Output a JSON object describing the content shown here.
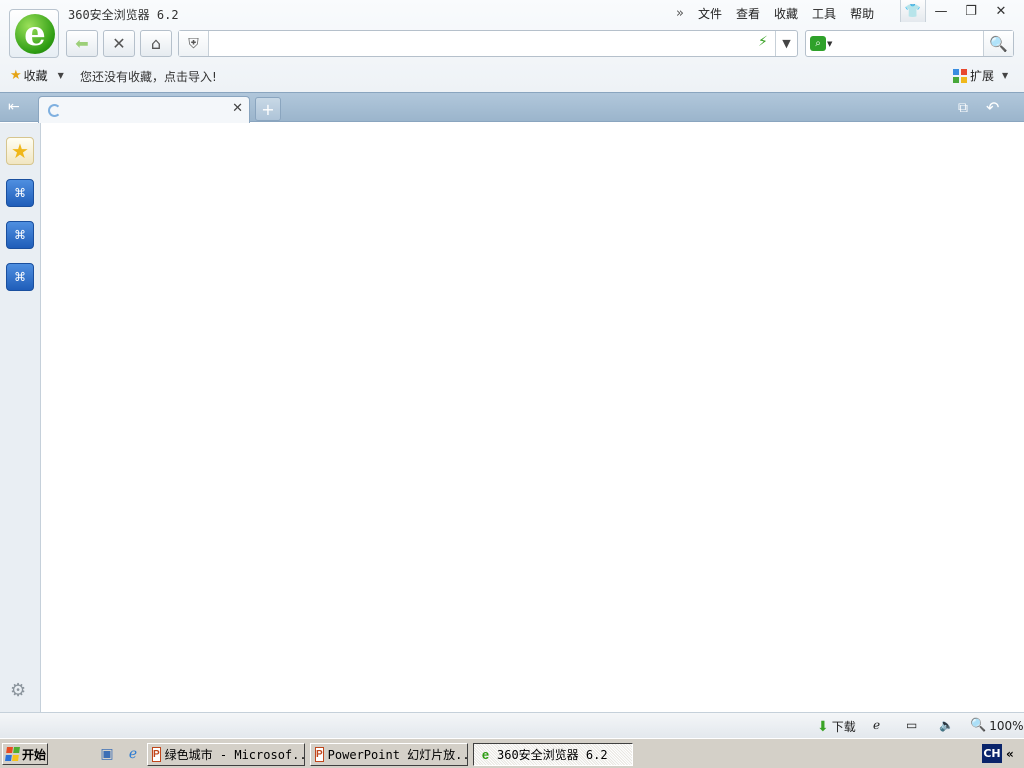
{
  "window": {
    "title": "360安全浏览器 6.2",
    "logo_letter": "e"
  },
  "menu": {
    "items": [
      "文件",
      "查看",
      "收藏",
      "工具",
      "帮助"
    ]
  },
  "address_bar": {
    "value": "",
    "placeholder": ""
  },
  "search_box": {
    "value": "",
    "placeholder": ""
  },
  "favorites_bar": {
    "menu_label": "收藏",
    "empty_message": "您还没有收藏，点击导入!",
    "extensions_label": "扩展"
  },
  "tabs": [
    {
      "title": "",
      "loading": true
    }
  ],
  "status_bar": {
    "download_label": "下载",
    "zoom": "100%"
  },
  "taskbar": {
    "start_label": "开始",
    "tasks": [
      {
        "label": "绿色城市 - Microsof...",
        "icon": "powerpoint-icon",
        "active": false
      },
      {
        "label": "PowerPoint 幻灯片放...",
        "icon": "powerpoint-icon",
        "active": false
      },
      {
        "label": "360安全浏览器 6.2",
        "icon": "browser-icon",
        "active": true
      }
    ],
    "ime": "CH"
  },
  "colors": {
    "tab_strip": "#a6bdd2",
    "sidebar": "#e9eef3",
    "logo_green": "#2d9c12",
    "app_button_blue": "#2f6fca",
    "taskbar": "#d4d0c8"
  }
}
